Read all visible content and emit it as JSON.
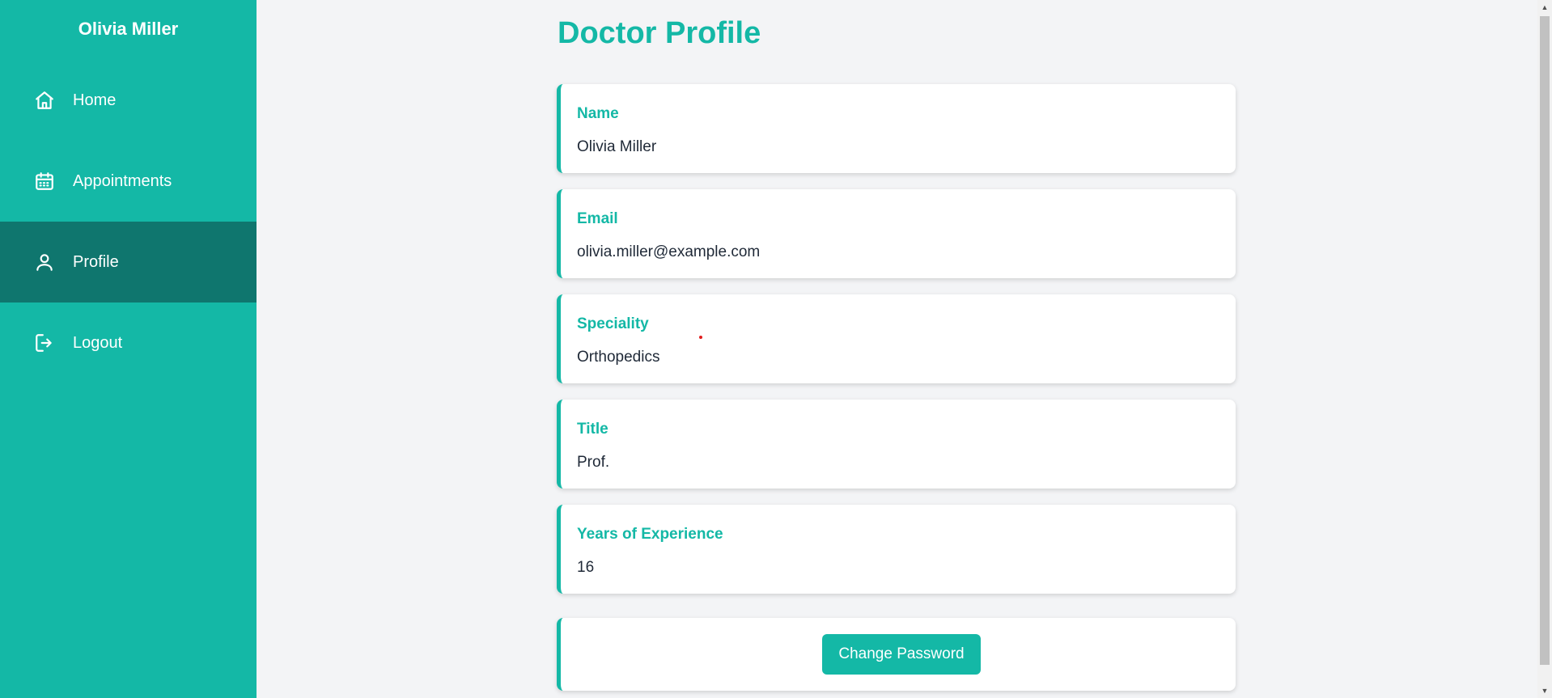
{
  "sidebar": {
    "user_name": "Olivia Miller",
    "items": [
      {
        "label": "Home",
        "icon": "home-icon",
        "active": false
      },
      {
        "label": "Appointments",
        "icon": "calendar-icon",
        "active": false
      },
      {
        "label": "Profile",
        "icon": "user-icon",
        "active": true
      },
      {
        "label": "Logout",
        "icon": "logout-icon",
        "active": false
      }
    ]
  },
  "main": {
    "title": "Doctor Profile",
    "fields": [
      {
        "label": "Name",
        "value": "Olivia Miller"
      },
      {
        "label": "Email",
        "value": "olivia.miller@example.com"
      },
      {
        "label": "Speciality",
        "value": "Orthopedics"
      },
      {
        "label": "Title",
        "value": "Prof."
      },
      {
        "label": "Years of Experience",
        "value": "16"
      }
    ],
    "change_password_label": "Change Password"
  },
  "colors": {
    "accent": "#14b8a6",
    "active_nav": "#0f766e",
    "background": "#f3f4f6"
  }
}
